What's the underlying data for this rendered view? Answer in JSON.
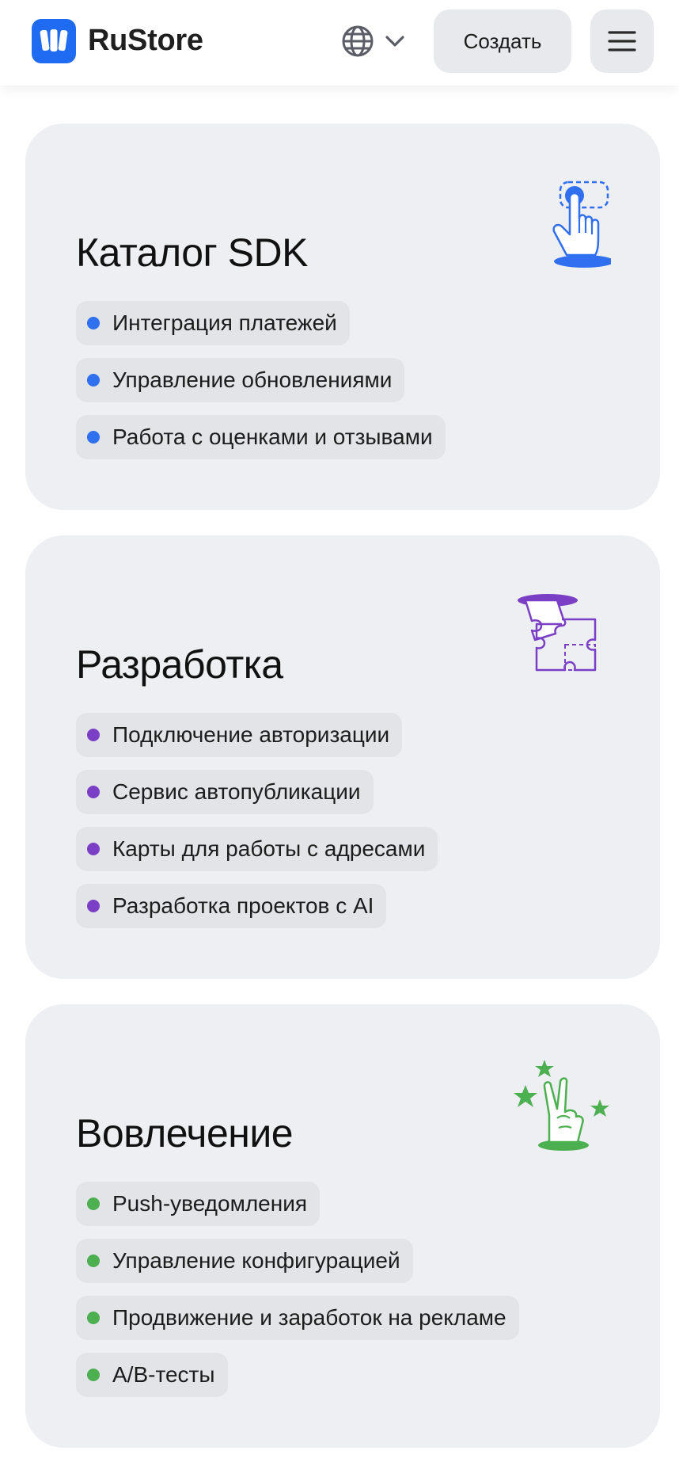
{
  "header": {
    "brand": "RuStore",
    "create_label": "Создать",
    "icons": [
      "rustore-logo-icon",
      "globe-icon",
      "chevron-down-icon",
      "hamburger-menu-icon"
    ]
  },
  "colors": {
    "blue": "#2f6ff0",
    "purple": "#7b3fc6",
    "green": "#4caf50",
    "card_bg": "#eeeff2",
    "chip_bg": "#e3e4e8"
  },
  "cards": [
    {
      "title": "Каталог SDK",
      "icon": "pointing-hand-icon",
      "items": [
        "Интеграция платежей",
        "Управление обновлениями",
        "Работа с оценками и отзывами"
      ]
    },
    {
      "title": "Разработка",
      "icon": "puzzle-icon",
      "items": [
        "Подключение авторизации",
        "Сервис автопубликации",
        "Карты для работы с адресами",
        "Разработка проектов с AI"
      ]
    },
    {
      "title": "Вовлечение",
      "icon": "victory-hand-stars-icon",
      "items": [
        "Push-уведомления",
        "Управление конфигурацией",
        "Продвижение и заработок на рекламе",
        "A/B-тесты"
      ]
    }
  ]
}
